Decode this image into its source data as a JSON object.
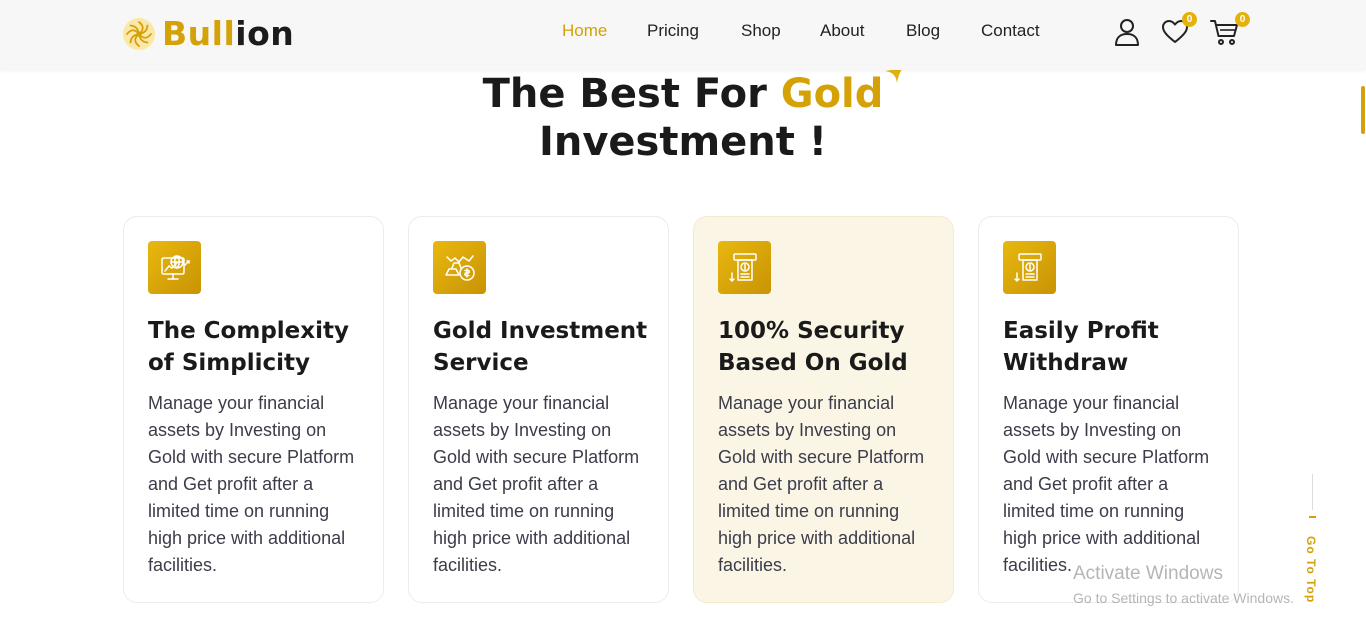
{
  "brand": {
    "name_part1": "Bull",
    "name_part2": "ion",
    "logo_icon": "sun-swirl-logo-icon"
  },
  "nav": {
    "items": [
      {
        "label": "Home",
        "active": true
      },
      {
        "label": "Pricing",
        "active": false
      },
      {
        "label": "Shop",
        "active": false
      },
      {
        "label": "About",
        "active": false
      },
      {
        "label": "Blog",
        "active": false
      },
      {
        "label": "Contact",
        "active": false
      }
    ]
  },
  "header_icons": {
    "user": "user-icon",
    "wishlist": "heart-icon",
    "wishlist_count": "0",
    "cart": "cart-icon",
    "cart_count": "0"
  },
  "hero": {
    "title_part1": "The Best For ",
    "title_highlight": "Gold",
    "title_part2": "Investment !"
  },
  "cards": [
    {
      "title": "The Complexity of Simplicity",
      "description": "Manage your financial assets by Investing on Gold with secure Platform and Get profit after a limited time on running high price with additional facilities.",
      "icon": "globe-chart-icon",
      "highlighted": false
    },
    {
      "title": "Gold Investment Service",
      "description": "Manage your financial assets by Investing on Gold with secure Platform and Get profit after a limited time on running high price with additional facilities.",
      "icon": "gold-bars-coin-icon",
      "highlighted": false
    },
    {
      "title": "100% Security Based On Gold",
      "description": "Manage your financial assets by Investing on Gold with secure Platform and Get profit after a limited time on running high price with additional facilities.",
      "icon": "atm-withdraw-icon",
      "highlighted": true
    },
    {
      "title": "Easily Profit Withdraw",
      "description": "Manage your financial assets by Investing on Gold with secure Platform and Get profit after a limited time on running high price with additional facilities.",
      "icon": "atm-withdraw-icon",
      "highlighted": false
    }
  ],
  "go_top": {
    "label": "Go To Top"
  },
  "watermark": {
    "line1": "Activate Windows",
    "line2": "Go to Settings to activate Windows."
  },
  "colors": {
    "accent": "#d4a106",
    "highlight_card_bg": "#fbf5e6",
    "text": "#1a1a1a"
  }
}
